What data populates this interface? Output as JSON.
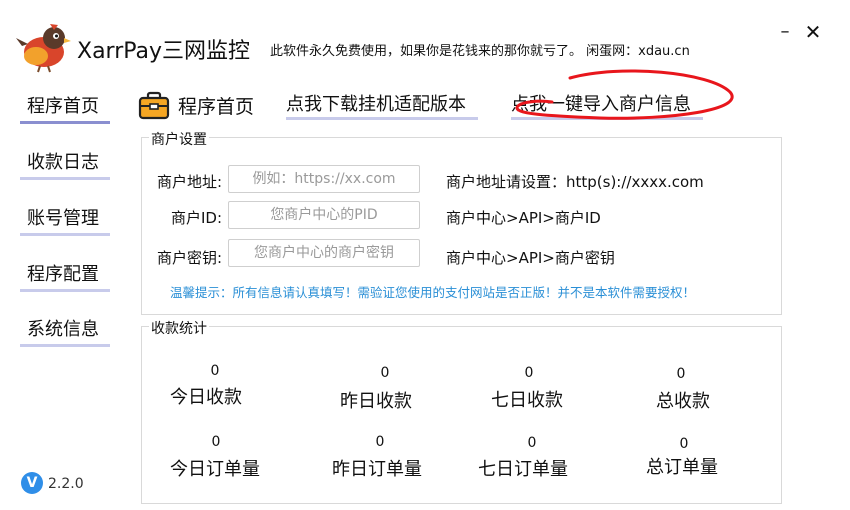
{
  "app": {
    "title": "XarrPay三网监控",
    "subtitle": "此软件永久免费使用，如果你是花钱来的那你就亏了。 闲蛋网：xdau.cn",
    "minimize_label": "–",
    "close_label": "✕"
  },
  "sidebar": {
    "items": [
      {
        "label": "程序首页",
        "active": true
      },
      {
        "label": "收款日志",
        "active": false
      },
      {
        "label": "账号管理",
        "active": false
      },
      {
        "label": "程序配置",
        "active": false
      },
      {
        "label": "系统信息",
        "active": false
      }
    ]
  },
  "tabs": {
    "home_label": "程序首页",
    "download_label": "点我下载挂机适配版本",
    "import_label": "点我一键导入商户信息"
  },
  "merchant": {
    "title": "商户设置",
    "fields": [
      {
        "label": "商户地址:",
        "placeholder": "例如：https://xx.com",
        "hint": "商户地址请设置：http(s)://xxxx.com"
      },
      {
        "label": "商户ID:",
        "placeholder": "您商户中心的PID",
        "hint": "商户中心>API>商户ID"
      },
      {
        "label": "商户密钥:",
        "placeholder": "您商户中心的商户密钥",
        "hint": "商户中心>API>商户密钥"
      }
    ],
    "tip": "温馨提示：所有信息请认真填写！需验证您使用的支付网站是否正版！并不是本软件需要授权！"
  },
  "stats": {
    "title": "收款统计",
    "row1": [
      {
        "value": "0",
        "label": "今日收款"
      },
      {
        "value": "0",
        "label": "昨日收款"
      },
      {
        "value": "0",
        "label": "七日收款"
      },
      {
        "value": "0",
        "label": "总收款"
      }
    ],
    "row2": [
      {
        "value": "0",
        "label": "今日订单量"
      },
      {
        "value": "0",
        "label": "昨日订单量"
      },
      {
        "value": "0",
        "label": "七日订单量"
      },
      {
        "value": "0",
        "label": "总订单量"
      }
    ]
  },
  "version": {
    "badge_letter": "V",
    "text": "2.2.0"
  },
  "colors": {
    "accent_underline": "#c8cbeb",
    "active_underline": "#8a8fd0",
    "tip_blue": "#2a8fd6",
    "annotation_red": "#e8161c",
    "version_badge": "#2f8ee8"
  }
}
